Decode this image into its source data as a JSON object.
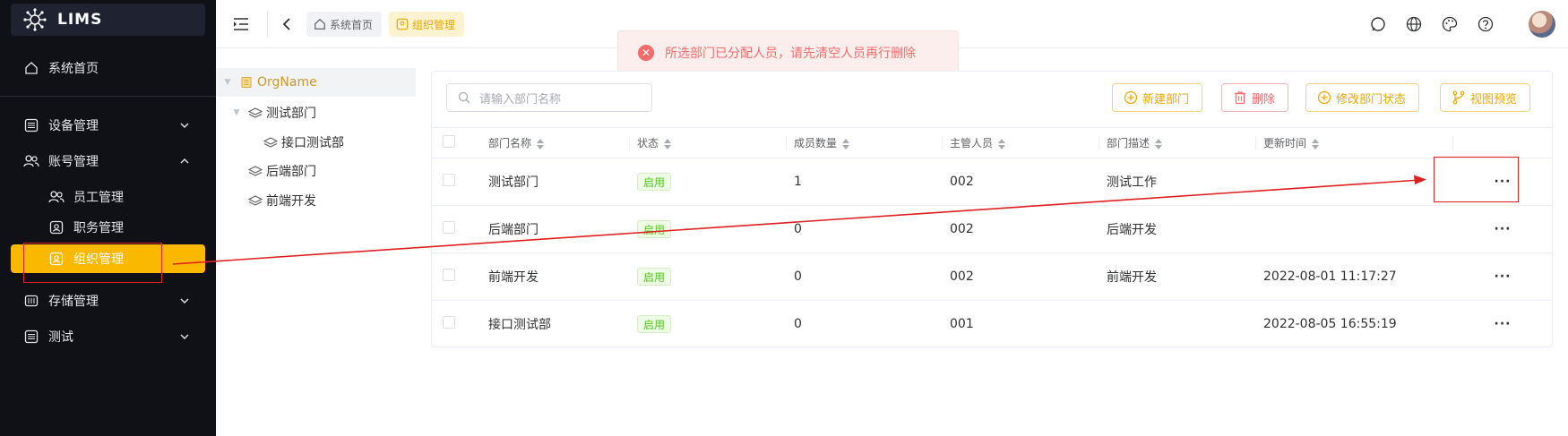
{
  "app": {
    "name": "LIMS"
  },
  "sidebar": {
    "items": [
      {
        "label": "系统首页"
      },
      {
        "label": "设备管理"
      },
      {
        "label": "账号管理"
      },
      {
        "label": "员工管理"
      },
      {
        "label": "职务管理"
      },
      {
        "label": "组织管理"
      },
      {
        "label": "存储管理"
      },
      {
        "label": "测试"
      }
    ]
  },
  "header": {
    "tabs": [
      {
        "label": "系统首页"
      },
      {
        "label": "组织管理"
      }
    ]
  },
  "toast": {
    "message": "所选部门已分配人员，请先清空人员再行删除"
  },
  "tree": {
    "root": "OrgName",
    "nodes": [
      "测试部门",
      "接口测试部",
      "后端部门",
      "前端开发"
    ]
  },
  "toolbar": {
    "search_placeholder": "请输入部门名称",
    "new_label": "新建部门",
    "delete_label": "删除",
    "status_label": "修改部门状态",
    "preview_label": "视图预览"
  },
  "table": {
    "columns": [
      "部门名称",
      "状态",
      "成员数量",
      "主管人员",
      "部门描述",
      "更新时间"
    ],
    "rows": [
      {
        "name": "测试部门",
        "status": "启用",
        "members": "1",
        "manager": "002",
        "desc": "测试工作",
        "updated": ""
      },
      {
        "name": "后端部门",
        "status": "启用",
        "members": "0",
        "manager": "002",
        "desc": "后端开发",
        "updated": ""
      },
      {
        "name": "前端开发",
        "status": "启用",
        "members": "0",
        "manager": "002",
        "desc": "前端开发",
        "updated": "2022-08-01 11:17:27"
      },
      {
        "name": "接口测试部",
        "status": "启用",
        "members": "0",
        "manager": "001",
        "desc": "",
        "updated": "2022-08-05 16:55:19"
      }
    ],
    "more_label": "···"
  },
  "colors": {
    "sidebar_bg": "#0f1117",
    "accent": "#fbb800",
    "error": "#f56c6c",
    "success": "#52c41a",
    "annotation": "#e02020"
  }
}
